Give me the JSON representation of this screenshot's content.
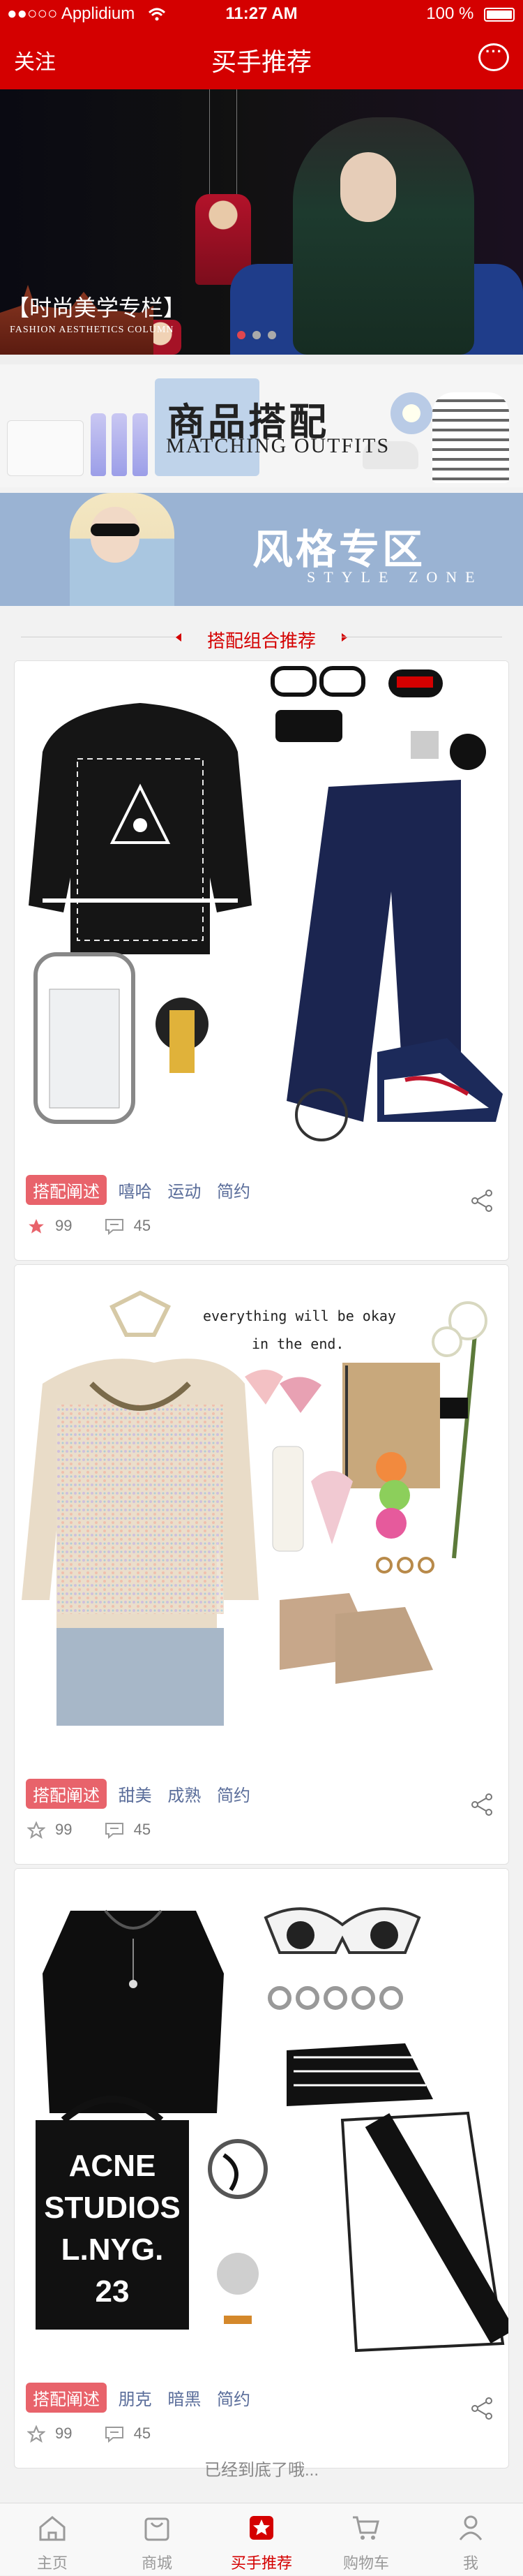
{
  "status_bar": {
    "carrier": "●●○○○ Applidium",
    "wifi_icon": "wifi-icon",
    "time": "11:27 AM",
    "battery": "100 %"
  },
  "navbar": {
    "left_label": "关注",
    "title": "买手推荐",
    "message_icon": "chat-bubble-icon"
  },
  "banner": {
    "caption": "【时尚美学专栏】",
    "subcaption": "FASHION AESTHETICS COLUMN",
    "dots": 3,
    "active_dot": 1
  },
  "promo_matching": {
    "title": "商品搭配",
    "subtitle": "MATCHING OUTFITS"
  },
  "promo_style": {
    "title": "风格专区",
    "subtitle": "STYLE ZONE"
  },
  "section_title": "搭配组合推荐",
  "cards": [
    {
      "tag_main": "搭配阐述",
      "tags": [
        "嘻哈",
        "运动",
        "简约"
      ],
      "likes": "99",
      "comments": "45",
      "liked": true
    },
    {
      "tag_main": "搭配阐述",
      "tags": [
        "甜美",
        "成熟",
        "简约"
      ],
      "likes": "99",
      "comments": "45",
      "liked": false,
      "image_text": "everything will be okay\nin the end."
    },
    {
      "tag_main": "搭配阐述",
      "tags": [
        "朋克",
        "暗黑",
        "简约"
      ],
      "likes": "99",
      "comments": "45",
      "liked": false,
      "image_text": "ACNE\nSTUDIOS\nL.NYG.\n23"
    }
  ],
  "end_text": "已经到底了哦...",
  "tabbar": [
    {
      "label": "主页",
      "icon": "home-icon"
    },
    {
      "label": "商城",
      "icon": "shopping-bag-icon"
    },
    {
      "label": "买手推荐",
      "icon": "star-badge-icon",
      "active": true
    },
    {
      "label": "购物车",
      "icon": "cart-icon"
    },
    {
      "label": "我",
      "icon": "user-icon"
    }
  ],
  "colors": {
    "brand": "#d40000",
    "tag": "#e8636b",
    "tag_text": "#5a6d9a"
  }
}
